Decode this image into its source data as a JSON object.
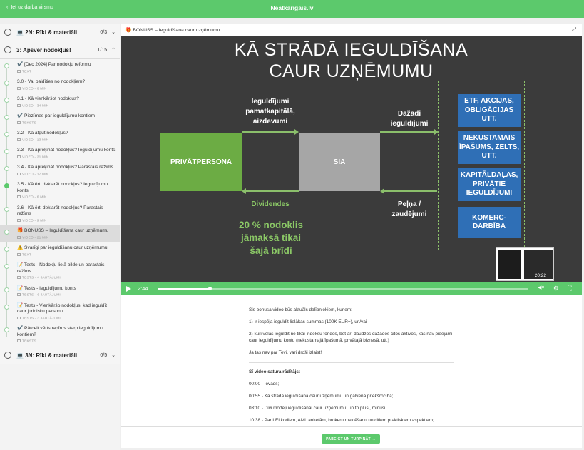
{
  "topbar": {
    "back_label": "Iet uz darba virsmu",
    "brand": "Neatkarīgais.lv"
  },
  "sidebar": {
    "sections": [
      {
        "icon": "laptop-icon",
        "title": "2N: Rīki & materiāli",
        "count": "0/3",
        "chevron": "⌄"
      },
      {
        "title": "3: Apsver nodokļus!",
        "count": "1/15",
        "chevron": "⌃"
      }
    ],
    "lessons": [
      {
        "title": "✔️ [Dec 2024] Par nodokļu reformu",
        "meta": "TEXT",
        "done": false
      },
      {
        "title": "3.0 - Vai baidīties no nodokļiem?",
        "meta": "VIDEO - 6 MIN",
        "done": false
      },
      {
        "title": "3.1 - Kā vienkāršot nodokļus?",
        "meta": "VIDEO - 34 MIN",
        "done": false
      },
      {
        "title": "✔️ Piezīmes par ieguldījumu kontiem",
        "meta": "TEKSTS",
        "done": false
      },
      {
        "title": "3.2 - Kā atgūt nodokļus?",
        "meta": "VIDEO - 13 MIN",
        "done": false
      },
      {
        "title": "3.3 - Kā aprēķināt nodokļus? Ieguldījumu konts",
        "meta": "VIDEO - 21 MIN",
        "done": false
      },
      {
        "title": "3.4 - Kā aprēķināt nodokļus? Parastais režīms",
        "meta": "VIDEO - 17 MIN",
        "done": false
      },
      {
        "title": "3.5 - Kā ērti deklarēt nodokļus? Ieguldījumu konts",
        "meta": "VIDEO - 6 MIN",
        "done": true
      },
      {
        "title": "3.6 - Kā ērti deklarēt nodokļus? Parastais režīms",
        "meta": "VIDEO - 9 MIN",
        "done": false
      },
      {
        "title": "🎁 BONUSS – Ieguldīšana caur uzņēmumu",
        "meta": "VIDEO - 21 MIN",
        "done": false,
        "active": true
      },
      {
        "title": "⚠️ Svarīgi par ieguldīšanu caur uzņēmumu",
        "meta": "TEXT",
        "done": false
      },
      {
        "title": "📝 Tests - Nodokļu lielā bilde un parastais režīms",
        "meta": "TESTS - 4 JAUTĀJUMI",
        "done": false
      },
      {
        "title": "📝 Tests - Ieguldījumu konts",
        "meta": "TESTS - 6 JAUTĀJUMI",
        "done": false
      },
      {
        "title": "📝 Tests - Vienkāršo nodokļus, kad ieguldīt caur juridisku personu",
        "meta": "TESTS - 3 JAUTĀJUMI",
        "done": false
      },
      {
        "title": "✔️ Pārcelt vērtspapīrus starp ieguldījumu kontiem?",
        "meta": "TEKSTS",
        "done": false
      }
    ],
    "bottom_section": {
      "icon": "laptop-icon",
      "title": "3N: Rīki & materiāli",
      "count": "0/5",
      "chevron": "⌄"
    }
  },
  "main": {
    "header_title": "🎁 BONUSS – Ieguldīšana caur uzņēmumu",
    "slide": {
      "title_line1": "KĀ STRĀDĀ IEGULDĪŠANA",
      "title_line2": "CAUR UZŅĒMUMU",
      "box_private": "PRIVĀTPERSONA",
      "box_sia": "SIA",
      "label_investments": "Ieguldījumi pamatkapitālā, aizdevumi",
      "label_various": "Dažādi ieguldījumi",
      "label_dividends": "Dividendes",
      "label_profit": "Peļņa / zaudējumi",
      "tax_note": "20 % nodoklis jāmaksā tikai šajā brīdī",
      "assets": [
        "ETF, AKCIJAS, OBLIGĀCIJAS UTT.",
        "NEKUSTAMAIS ĪPAŠUMS, ZELTS, UTT.",
        "KAPITĀLDAĻAS, PRIVĀTIE IEGULDĪJUMI",
        "KOMERC-DARBĪBA"
      ],
      "thumb_time": "20:22"
    },
    "player": {
      "current_time": "2:44",
      "progress": 0.14,
      "speed_label": "◀×"
    },
    "description": {
      "p1": "Šis bonusa video būs aktuāls dalībniekiem, kuriem:",
      "p2": "1) Ir iespēja ieguldīt lielākas summas (100K EUR+), un/vai",
      "p3": "2) kuri vēlas ieguldīt ne tikai indeksu fondos, bet arī daudzos dažādos citos aktīvos, kas nav pieejami caur ieguldījumu kontu (nekustamajā īpašumā, privātajā biznesā, utt.)",
      "p4": "Ja tas nav par Tevi, vari droši izlaist!",
      "toc_title": "Šī video satura rādītājs:",
      "toc": [
        "00:00 - Ievads;",
        "00:55 - Kā strādā ieguldīšana caur uzņēmumu un galvenā priekšrocība;",
        "03:10 - Divi modeļi ieguldīšanai caur uzņēmumu: un to plusi, mīnusi;",
        "10:38 - Par LEI kodiem, AML anketām, brokeru meklēšanu un citiem praktiskiem aspektiem;"
      ]
    },
    "finish_button": "PABEIGT UN TURPINĀT →"
  }
}
